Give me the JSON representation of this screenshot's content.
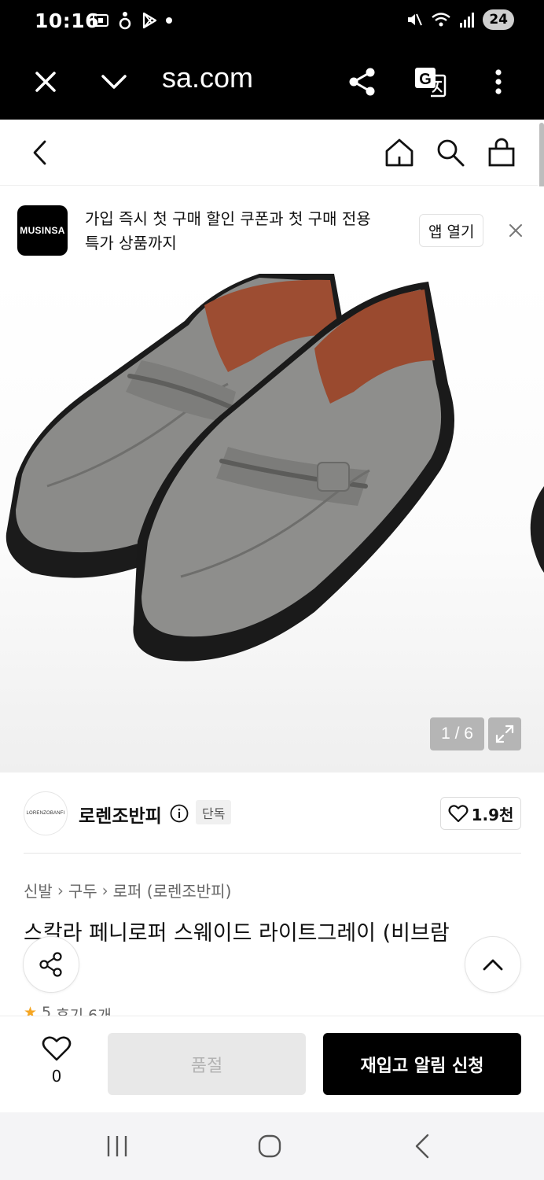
{
  "status_bar": {
    "time": "10:16",
    "battery": "24"
  },
  "browser": {
    "url": "sa.com"
  },
  "app_banner": {
    "logo_text": "MUSINSA",
    "line1": "가입 즉시 첫 구매 할인 쿠폰과 첫 구매 전용",
    "line2": "특가 상품까지",
    "open_app_label": "앱 열기"
  },
  "gallery": {
    "counter": "1 / 6"
  },
  "brand": {
    "logo_text": "LORENZOBANFI",
    "name": "로렌조반피",
    "badge": "단독",
    "likes": "1.9천"
  },
  "breadcrumb": [
    "신발",
    "구두",
    "로퍼 (로렌조반피)"
  ],
  "product": {
    "title": "스칼라 페니로퍼 스웨이드 라이트그레이 (비브람",
    "rating": "5",
    "reviews": "후기 6개"
  },
  "action_bar": {
    "wish_count": "0",
    "soldout_label": "품절",
    "restock_label": "재입고 알림 신청"
  },
  "colors": {
    "accent": "#000000",
    "disabled_bg": "#e8e8e8",
    "star": "#f5a623"
  }
}
